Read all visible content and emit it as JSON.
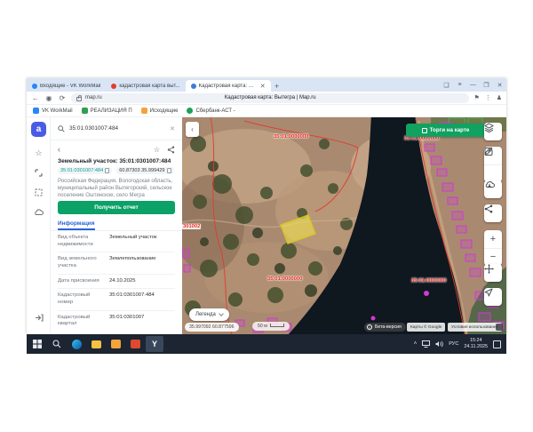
{
  "browser": {
    "tabs": [
      {
        "label": "Входящие - VK WorkMail"
      },
      {
        "label": "кадастровая карта выт..."
      },
      {
        "label": "Кадастровая карта: В..."
      }
    ],
    "new_tab_label": "+",
    "url": "map.ru",
    "page_title": "Кадастровая карта: Вытегра | Map.ru",
    "bookmarks": [
      {
        "label": "VK WorkMail"
      },
      {
        "label": "РЕАЛИЗАЦИЯ П"
      },
      {
        "label": "Исходящие"
      },
      {
        "label": "Сбербанк-АСТ -"
      }
    ]
  },
  "sidebar": {
    "search_value": "35:01:0301007:484",
    "title": "Земельный участок: 35:01:0301007:484",
    "cadastral_chip": "35:01:0301007:484",
    "coords_chip": "60.87303 35.999429",
    "address": "Российская Федерация, Вологодская область, муниципальный район Вытегорский, сельское поселение Оштинское, село Мегра",
    "report_button": "Получить отчет",
    "tab_info": "Информация",
    "info_rows": [
      {
        "label": "Вид объекта недвижимости",
        "value": "Земельный участок"
      },
      {
        "label": "Вид земельного участка",
        "value": "Землепользование"
      },
      {
        "label": "Дата присвоения",
        "value": "24.10.2025"
      },
      {
        "label": "Кадастровый номер",
        "value": "35:01:0301007:484"
      },
      {
        "label": "Кадастровый квартал",
        "value": "35:01:0301007"
      }
    ]
  },
  "map": {
    "torgi_button": "Торги на карте",
    "legend_button": "Легенда",
    "coordinates": "35.997092 60.877596",
    "scale": "50 м",
    "beta_badge": "Бета-версия",
    "attribution_maps": "Карты © Google",
    "attribution_terms": "Условия использования",
    "labels": [
      "35:01:0000000",
      "35:01:0000000",
      "35:01:0000000",
      "35:01:0000000",
      "301002"
    ]
  },
  "taskbar": {
    "yandex_letter": "Y",
    "language": "РУС",
    "time": "15:24",
    "date": "24.11.2025"
  },
  "colors": {
    "accent_green": "#0ba167",
    "link_teal": "#0a9c94",
    "tab_blue": "#2a62d9",
    "label_red": "#e8281e",
    "parcel_magenta": "#d03ad0",
    "selected_yellow": "#f3e94a",
    "taskbar_dark": "#1c2531",
    "tabstrip_blue": "#d9e5f5"
  }
}
